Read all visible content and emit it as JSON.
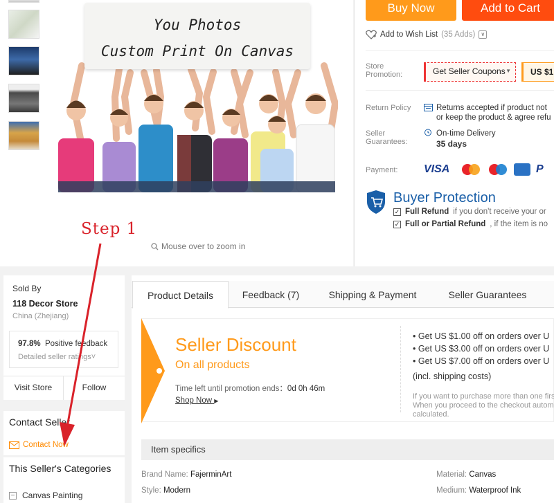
{
  "gallery": {
    "thumbnails": [
      "thumb-1",
      "thumb-2",
      "thumb-3",
      "thumb-4"
    ],
    "sign_line1": "You Photos",
    "sign_line2": "Custom Print On Canvas",
    "zoom_hint": "Mouse over to zoom in"
  },
  "annotation": {
    "step_label": "Step 1",
    "color": "#d9222a"
  },
  "purchase": {
    "buy_now": "Buy Now",
    "add_to_cart": "Add to Cart",
    "wishlist_label": "Add to Wish List",
    "wishlist_count": "(35 Adds)"
  },
  "info": {
    "store_promotion_label": "Store Promotion:",
    "coupon_label": "Get Seller Coupons",
    "coupon_badge": "US $1",
    "return_policy_label": "Return Policy",
    "return_text_1": "Returns accepted if product not",
    "return_text_2": "or keep the product & agree refu",
    "seller_guarantees_label": "Seller Guarantees:",
    "delivery_label": "On-time Delivery",
    "delivery_days": "35 days",
    "payment_label": "Payment:",
    "payment_methods": [
      "VISA",
      "MasterCard",
      "Maestro",
      "American Express",
      "PayPal"
    ]
  },
  "buyer_protection": {
    "title": "Buyer Protection",
    "line1_bold": "Full Refund",
    "line1_rest": "if you don't receive your or",
    "line2_bold": "Full or Partial Refund",
    "line2_rest": ", if the item is no"
  },
  "seller": {
    "sold_by_label": "Sold By",
    "store_name": "118 Decor Store",
    "location": "China (Zhejiang)",
    "rating_value": "97.8%",
    "rating_label": "Positive feedback",
    "rating_details": "Detailed seller ratings",
    "visit_store": "Visit Store",
    "follow": "Follow"
  },
  "contact": {
    "title": "Contact Seller",
    "contact_now": "Contact Now"
  },
  "categories": {
    "title": "This Seller's Categories",
    "item": "Canvas Painting"
  },
  "tabs": {
    "product_details": "Product Details",
    "feedback": "Feedback (7)",
    "shipping_payment": "Shipping & Payment",
    "seller_guarantees": "Seller Guarantees"
  },
  "discount": {
    "title": "Seller Discount",
    "subtitle": "On all products",
    "time_left_label": "Time left until promotion ends：",
    "time_left_value": "0d 0h 46m",
    "shop_now": "Shop Now",
    "rules": [
      "• Get US $1.00 off on orders over U",
      "• Get US $3.00 off on orders over U",
      "• Get US $7.00 off on orders over U"
    ],
    "incl_shipping": "(incl. shipping costs)",
    "note": "If you want to purchase more than one first. When you proceed to the checkout automatically calculated."
  },
  "specs": {
    "header": "Item specifics",
    "items": [
      {
        "label": "Brand Name:",
        "value": "FajerminArt"
      },
      {
        "label": "Material:",
        "value": "Canvas"
      },
      {
        "label": "Style:",
        "value": "Modern"
      },
      {
        "label": "Medium:",
        "value": "Waterproof Ink"
      }
    ]
  },
  "colors": {
    "buy_now": "#ff9a1b",
    "add_to_cart": "#ff4c0f",
    "brand_blue": "#1a5fa8",
    "discount_orange": "#ff9a1b",
    "contact_orange": "#ff8a00"
  }
}
